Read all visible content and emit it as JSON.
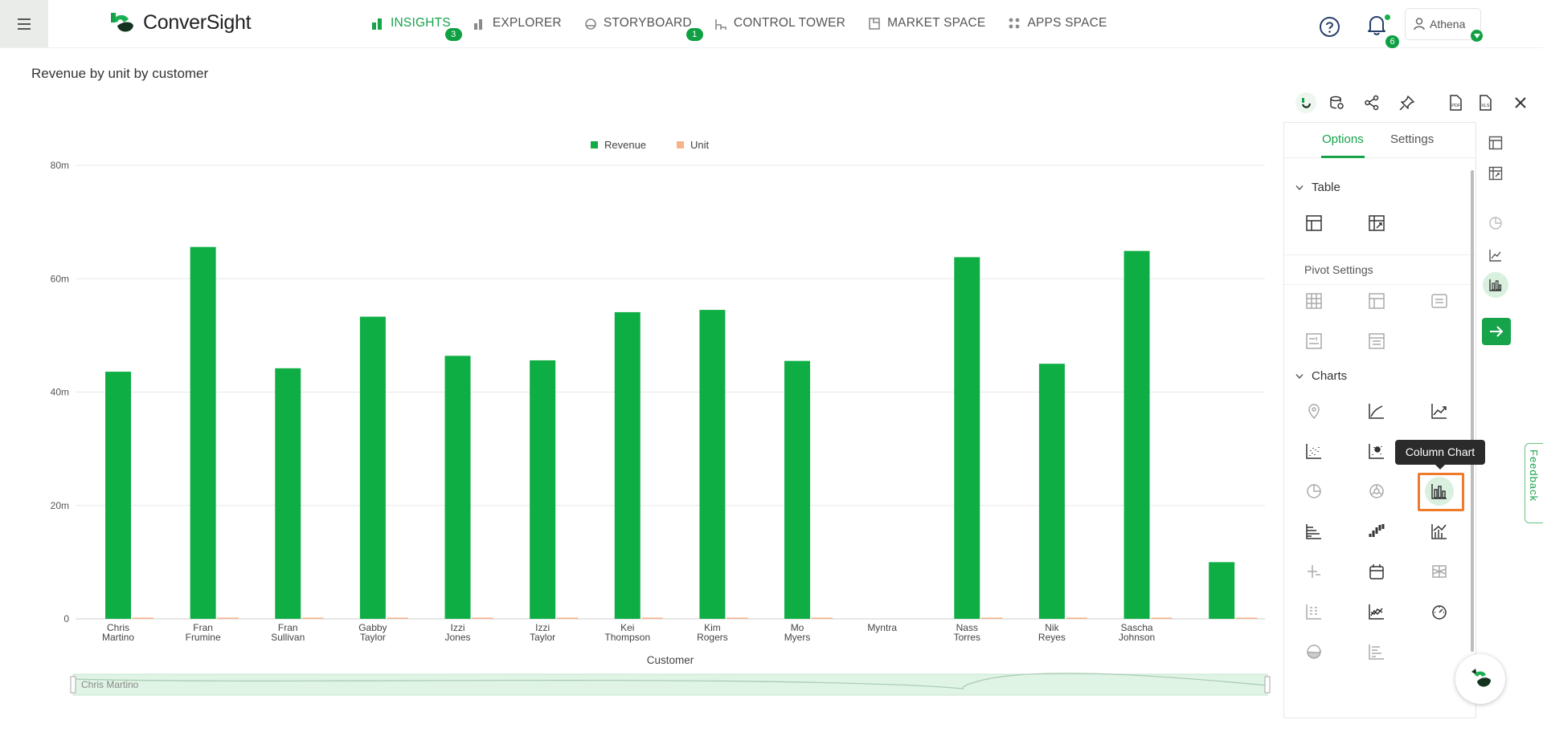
{
  "app": {
    "brand": "ConverSight",
    "nav": [
      {
        "label": "INSIGHTS",
        "badge": "3",
        "active": true,
        "icon": "insights-bar-icon"
      },
      {
        "label": "EXPLORER",
        "badge": "",
        "active": false,
        "icon": "explorer-bar-icon"
      },
      {
        "label": "STORYBOARD",
        "badge": "1",
        "active": false,
        "icon": "storyboard-icon"
      },
      {
        "label": "CONTROL TOWER",
        "badge": "",
        "active": false,
        "icon": "control-tower-icon"
      },
      {
        "label": "MARKET SPACE",
        "badge": "",
        "active": false,
        "icon": "market-space-icon"
      },
      {
        "label": "APPS SPACE",
        "badge": "",
        "active": false,
        "icon": "apps-space-icon"
      }
    ],
    "notifications_count": "6",
    "user_name": "Athena"
  },
  "page_title": "Revenue by unit by customer",
  "chart_data": {
    "type": "bar",
    "title": "",
    "xlabel": "Customer",
    "ylabel": "",
    "categories": [
      "Chris Martino",
      "Fran Frumine",
      "Fran Sullivan",
      "Gabby Taylor",
      "Izzi Jones",
      "Izzi Taylor",
      "Kei Thompson",
      "Kim Rogers",
      "Mo Myers",
      "Myntra",
      "Nass Torres",
      "Nik Reyes",
      "Sascha Johnson",
      ""
    ],
    "series": [
      {
        "name": "Revenue",
        "color": "#0fae45",
        "values": [
          43.6,
          65.6,
          44.2,
          53.3,
          46.4,
          45.6,
          54.1,
          54.5,
          45.5,
          0,
          63.8,
          45.0,
          64.9,
          10.0
        ]
      },
      {
        "name": "Unit",
        "color": "#f6b38a",
        "values": [
          0.05,
          0.05,
          0.05,
          0.05,
          0.05,
          0.05,
          0.05,
          0.05,
          0.05,
          0,
          0.05,
          0.05,
          0.05,
          0.01
        ]
      }
    ],
    "ytick_labels": [
      "0",
      "20m",
      "40m",
      "60m",
      "80m"
    ],
    "ylim": [
      0,
      80
    ],
    "grid": true,
    "legend_position": "top-center",
    "slider_label": "Chris Martino"
  },
  "panel": {
    "tabs": [
      {
        "label": "Options",
        "active": true
      },
      {
        "label": "Settings",
        "active": false
      }
    ],
    "sections": {
      "table": "Table",
      "pivot": "Pivot Settings",
      "charts": "Charts"
    },
    "tooltip": "Column Chart"
  },
  "feedback_label": "Feedback",
  "colors": {
    "accent": "#16a34a",
    "revenue": "#0fae45",
    "unit": "#f6b38a",
    "highlight": "#ef7a2a"
  }
}
